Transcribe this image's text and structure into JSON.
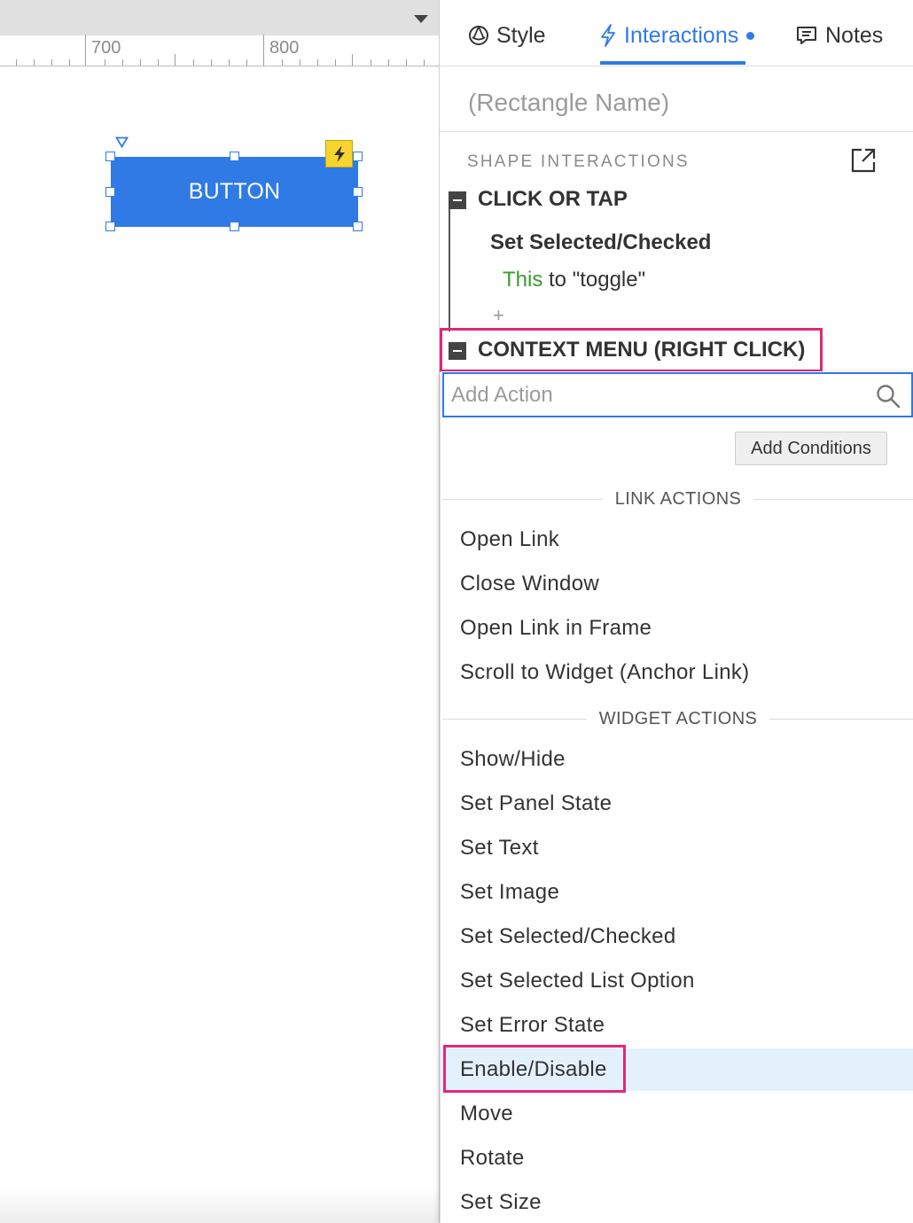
{
  "canvas": {
    "ruler_labels": [
      "700",
      "800"
    ],
    "widget_label": "BUTTON"
  },
  "panel": {
    "tabs": [
      {
        "label": "Style",
        "icon": "style-icon"
      },
      {
        "label": "Interactions",
        "icon": "lightning-icon",
        "active": true
      },
      {
        "label": "Notes",
        "icon": "notes-icon"
      }
    ],
    "widget_name_placeholder": "(Rectangle Name)",
    "section_title": "SHAPE INTERACTIONS",
    "events": [
      {
        "label": "CLICK OR TAP",
        "actions": [
          {
            "label": "Set Selected/Checked",
            "target": "This",
            "detail": " to \"toggle\""
          }
        ],
        "add_symbol": "+"
      },
      {
        "label": "CONTEXT MENU (RIGHT CLICK)"
      }
    ]
  },
  "dropdown": {
    "search_placeholder": "Add Action",
    "add_conditions_label": "Add Conditions",
    "groups": [
      {
        "title": "LINK ACTIONS",
        "items": [
          "Open Link",
          "Close Window",
          "Open Link in Frame",
          "Scroll to Widget (Anchor Link)"
        ]
      },
      {
        "title": "WIDGET ACTIONS",
        "items": [
          "Show/Hide",
          "Set Panel State",
          "Set Text",
          "Set Image",
          "Set Selected/Checked",
          "Set Selected List Option",
          "Set Error State",
          "Enable/Disable",
          "Move",
          "Rotate",
          "Set Size"
        ]
      }
    ],
    "selected_item": "Enable/Disable"
  },
  "colors": {
    "accent": "#2f7ae5",
    "highlight_frame": "#e0287a",
    "target_text": "#3a9a2e",
    "selected_row": "#e3f1fd"
  }
}
